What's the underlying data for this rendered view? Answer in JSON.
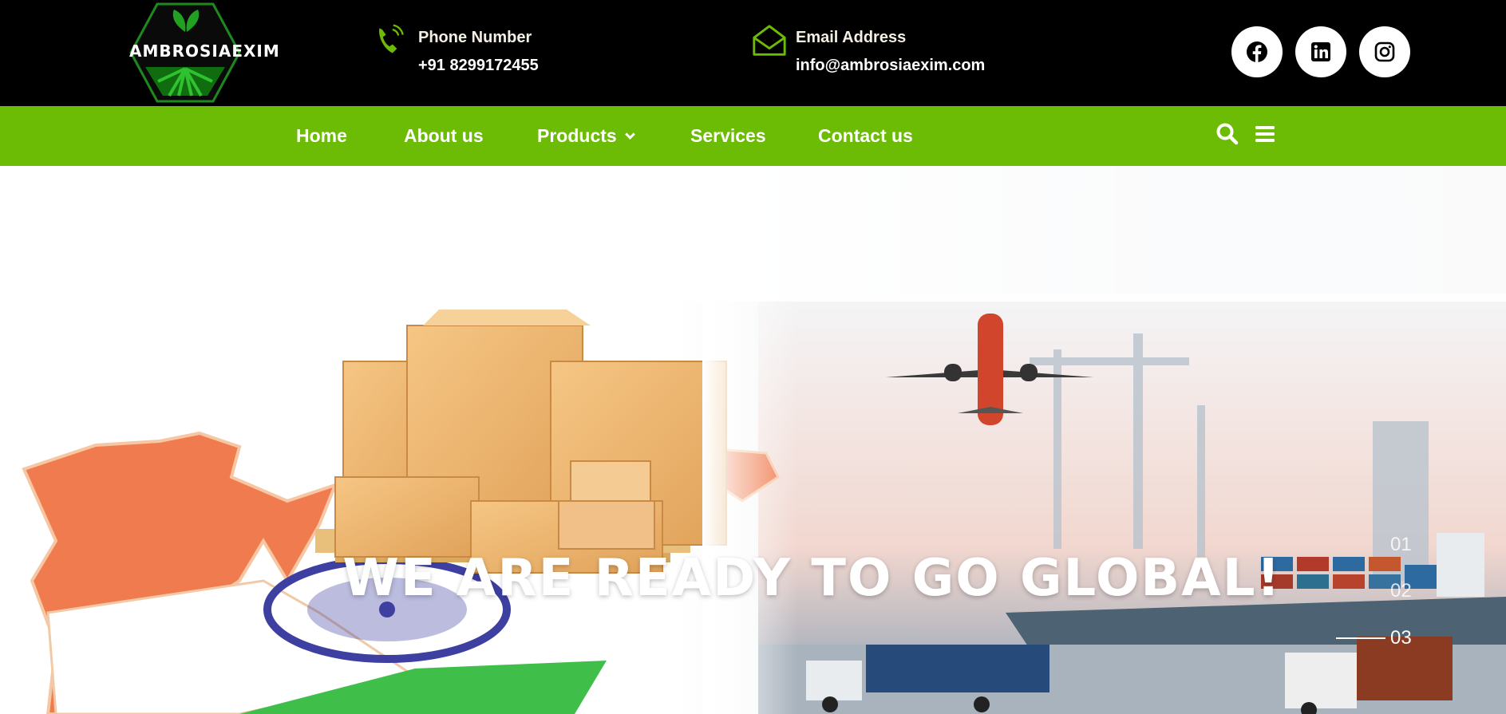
{
  "header": {
    "logo_text": "AMBROSIAEXIM",
    "phone": {
      "label": "Phone Number",
      "value": "+91 8299172455",
      "icon": "phone-icon"
    },
    "email": {
      "label": "Email Address",
      "value": "info@ambrosiaexim.com",
      "icon": "envelope-open-icon"
    },
    "social": [
      {
        "name": "facebook",
        "icon": "facebook-icon"
      },
      {
        "name": "linkedin",
        "icon": "linkedin-icon"
      },
      {
        "name": "instagram",
        "icon": "instagram-icon"
      }
    ]
  },
  "nav": {
    "items": [
      {
        "label": "Home"
      },
      {
        "label": "About us"
      },
      {
        "label": "Products",
        "has_dropdown": true
      },
      {
        "label": "Services"
      },
      {
        "label": "Contact us"
      }
    ],
    "icons": [
      "search-icon",
      "hamburger-menu-icon"
    ]
  },
  "hero": {
    "headline": "WE ARE READY TO GO GLOBAL!",
    "slides": [
      {
        "number": "01",
        "active": false
      },
      {
        "number": "02",
        "active": false
      },
      {
        "number": "03",
        "active": true
      }
    ]
  },
  "colors": {
    "accent_green": "#6cbb04",
    "topbar_bg": "#000000",
    "text_white": "#ffffff"
  }
}
